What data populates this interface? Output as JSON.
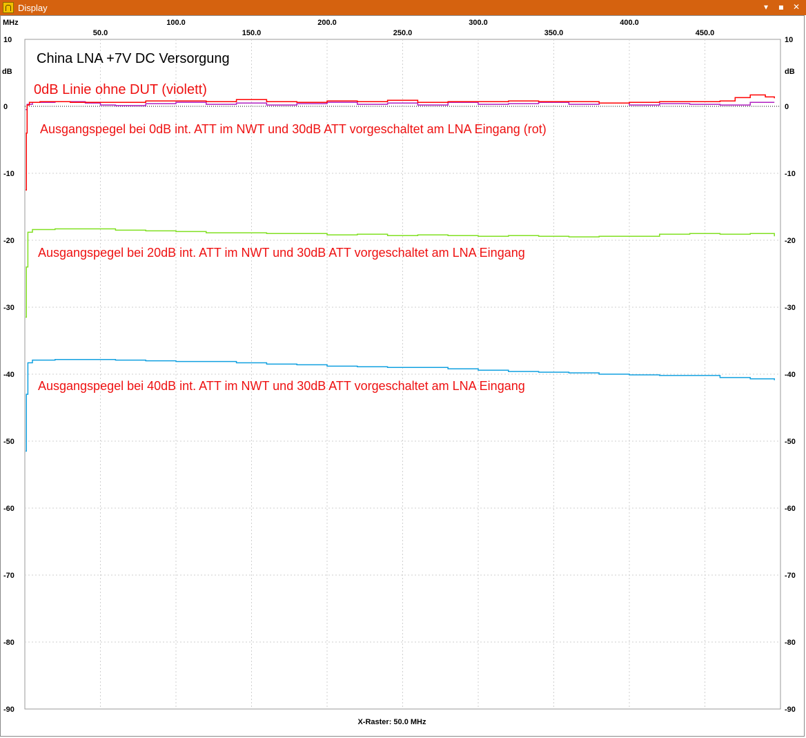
{
  "window": {
    "title": "Display",
    "controls": {
      "minimize": "▾",
      "maximize": "▪",
      "close": "✕"
    }
  },
  "chart_data": {
    "type": "line",
    "x_unit_label": "MHz",
    "y_unit_label": "dB",
    "xlim": [
      0,
      500
    ],
    "ylim": [
      -90,
      10
    ],
    "x_ticks": [
      "50.0",
      "100.0",
      "150.0",
      "200.0",
      "250.0",
      "300.0",
      "350.0",
      "400.0",
      "450.0"
    ],
    "y_ticks": [
      "10",
      "0",
      "-10",
      "-20",
      "-30",
      "-40",
      "-50",
      "-60",
      "-70",
      "-80",
      "-90"
    ],
    "x_raster_label": "X-Raster: 50.0 MHz",
    "grid": true,
    "colors": {
      "violet": "#b020c0",
      "red": "#ff0000",
      "green": "#80e020",
      "blue": "#10a0e0",
      "annotation": "#ee1111",
      "zero_line": "#000000"
    },
    "annotations": {
      "title": "China LNA +7V DC Versorgung",
      "violet_note": "0dB Linie ohne DUT (violett)",
      "red_note": "Ausgangspegel bei 0dB int. ATT im NWT und 30dB ATT vorgeschaltet am LNA Eingang (rot)",
      "green_note": "Ausgangspegel bei 20dB int. ATT im NWT und 30dB ATT vorgeschaltet am LNA Eingang",
      "blue_note": "Ausgangspegel bei 40dB int. ATT im NWT und 30dB ATT vorgeschaltet am LNA Eingang"
    },
    "series": [
      {
        "color": "violet",
        "x": [
          0.5,
          1.5,
          5,
          20,
          40,
          50,
          60,
          80,
          100,
          120,
          140,
          160,
          180,
          200,
          220,
          240,
          260,
          280,
          300,
          320,
          340,
          360,
          380,
          400,
          420,
          440,
          460,
          480,
          496
        ],
        "y": [
          -0.5,
          0.3,
          0.6,
          0.7,
          0.5,
          0.2,
          0.1,
          0.4,
          0.6,
          0.3,
          0.5,
          0.2,
          0.4,
          0.6,
          0.3,
          0.5,
          0.2,
          0.6,
          0.3,
          0.4,
          0.6,
          0.3,
          0.5,
          0.2,
          0.4,
          0.3,
          0.2,
          0.6,
          0.6
        ]
      },
      {
        "color": "red",
        "x": [
          0.5,
          1.0,
          1.5,
          3,
          10,
          30,
          60,
          80,
          100,
          120,
          140,
          160,
          180,
          200,
          220,
          240,
          260,
          280,
          300,
          320,
          340,
          360,
          380,
          400,
          420,
          440,
          460,
          470,
          480,
          490,
          496
        ],
        "y": [
          -12.5,
          -4,
          0.2,
          0.6,
          0.7,
          0.6,
          0.6,
          0.8,
          0.8,
          0.7,
          1.0,
          0.7,
          0.6,
          0.8,
          0.7,
          0.9,
          0.6,
          0.7,
          0.7,
          0.8,
          0.7,
          0.7,
          0.5,
          0.6,
          0.7,
          0.7,
          0.8,
          1.3,
          1.7,
          1.4,
          1.2
        ]
      },
      {
        "color": "green",
        "x": [
          0.5,
          1.0,
          2,
          5,
          20,
          40,
          60,
          80,
          100,
          120,
          140,
          160,
          180,
          200,
          220,
          240,
          260,
          280,
          300,
          320,
          340,
          360,
          380,
          400,
          420,
          440,
          460,
          480,
          496
        ],
        "y": [
          -31.5,
          -24,
          -18.8,
          -18.4,
          -18.3,
          -18.3,
          -18.5,
          -18.6,
          -18.7,
          -18.9,
          -18.9,
          -19.0,
          -19.0,
          -19.2,
          -19.1,
          -19.3,
          -19.2,
          -19.3,
          -19.4,
          -19.3,
          -19.4,
          -19.5,
          -19.4,
          -19.4,
          -19.1,
          -19.0,
          -19.1,
          -19.0,
          -19.4
        ]
      },
      {
        "color": "blue",
        "x": [
          0.5,
          1.0,
          2,
          5,
          20,
          40,
          60,
          80,
          100,
          120,
          140,
          160,
          180,
          200,
          220,
          240,
          260,
          280,
          300,
          320,
          340,
          360,
          380,
          400,
          420,
          440,
          460,
          480,
          496
        ],
        "y": [
          -51.5,
          -43,
          -38.3,
          -37.9,
          -37.8,
          -37.8,
          -37.9,
          -38.0,
          -38.1,
          -38.1,
          -38.3,
          -38.5,
          -38.6,
          -38.8,
          -38.9,
          -39.0,
          -39.0,
          -39.2,
          -39.4,
          -39.6,
          -39.7,
          -39.8,
          -40.0,
          -40.1,
          -40.2,
          -40.2,
          -40.5,
          -40.7,
          -40.9
        ]
      }
    ]
  }
}
